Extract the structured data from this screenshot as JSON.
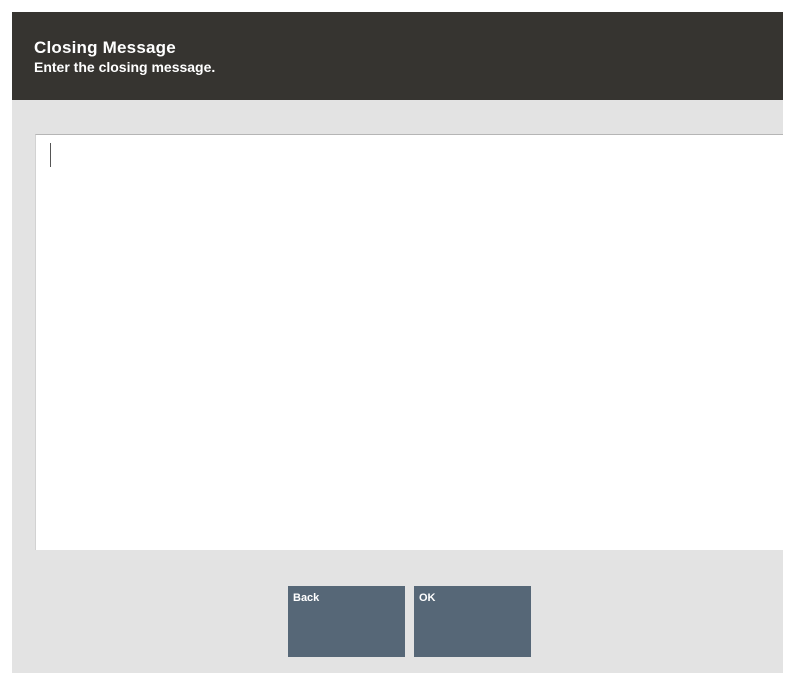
{
  "header": {
    "title": "Closing Message",
    "subtitle": "Enter the closing message."
  },
  "message": {
    "value": ""
  },
  "buttons": {
    "back_label": "Back",
    "ok_label": "OK"
  },
  "colors": {
    "header_bg": "#363430",
    "panel_bg": "#e3e3e3",
    "button_bg": "#566777",
    "button_text": "#ffffff"
  }
}
